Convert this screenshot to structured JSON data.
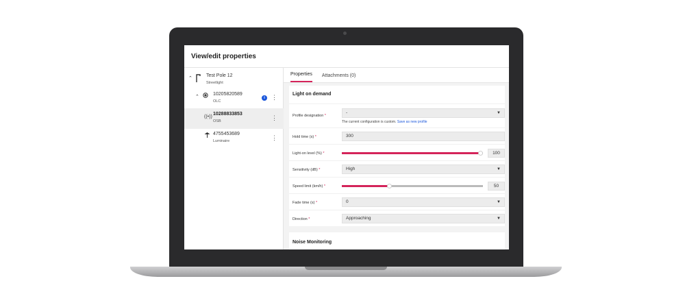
{
  "header": {
    "title": "View/edit properties"
  },
  "tree": {
    "nodes": [
      {
        "name": "Test Pole 12",
        "type": "Streetlight",
        "icon": "streetlight-icon"
      },
      {
        "name": "10205820589",
        "type": "OLC",
        "icon": "olc-icon",
        "info_badge": "i"
      },
      {
        "name": "10288833853",
        "type": "OSB",
        "icon": "sensor-icon",
        "selected": true
      },
      {
        "name": "4755453689",
        "type": "Luminaire",
        "icon": "luminaire-icon"
      }
    ]
  },
  "tabs": [
    {
      "label": "Properties",
      "active": true
    },
    {
      "label": "Attachments (0)",
      "active": false
    }
  ],
  "section": {
    "title": "Light on demand",
    "profile_designation": {
      "label": "Profile designation",
      "value": "-",
      "hint": "The current configuration is custom.",
      "hint_link": "Save as new profile"
    },
    "hold_time": {
      "label": "Hold time (s)",
      "value": "300"
    },
    "light_on_level": {
      "label": "Light-on level (%)",
      "value": "100",
      "level": 100
    },
    "sensitivity": {
      "label": "Sensitivity (dB)",
      "value": "High"
    },
    "speed_limit": {
      "label": "Speed limit (km/h)",
      "value": "50",
      "level": 0.35
    },
    "fade_time": {
      "label": "Fade time (s)",
      "value": "0"
    },
    "direction": {
      "label": "Direction",
      "value": "Approaching"
    }
  },
  "section2": {
    "title": "Noise Monitoring"
  },
  "required_marker": "*",
  "colors": {
    "accent": "#d4245a",
    "link": "#1a56db"
  }
}
